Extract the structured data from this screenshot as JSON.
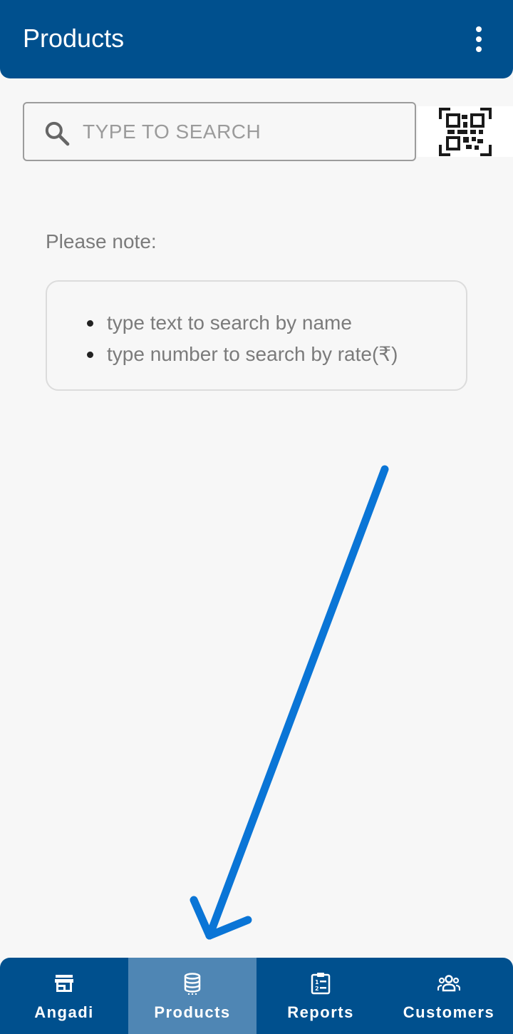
{
  "app_bar": {
    "title": "Products",
    "menu_icon": "more-vert-icon"
  },
  "search": {
    "placeholder": "TYPE TO SEARCH",
    "value": "",
    "icon": "search-icon",
    "qr_icon": "qr-code-scan-icon"
  },
  "note": {
    "title": "Please note:",
    "items": [
      "type text to search by name",
      "type number to search by rate(₹)"
    ]
  },
  "bottom_nav": {
    "items": [
      {
        "label": "Angadi",
        "icon": "store-icon"
      },
      {
        "label": "Products",
        "icon": "database-icon"
      },
      {
        "label": "Reports",
        "icon": "clipboard-list-icon"
      },
      {
        "label": "Customers",
        "icon": "group-icon"
      }
    ],
    "active_index": 1
  },
  "colors": {
    "primary": "#00508e",
    "active_tab": "#4f86b4",
    "annotation_arrow": "#0a75d6",
    "background": "#f7f7f7"
  }
}
